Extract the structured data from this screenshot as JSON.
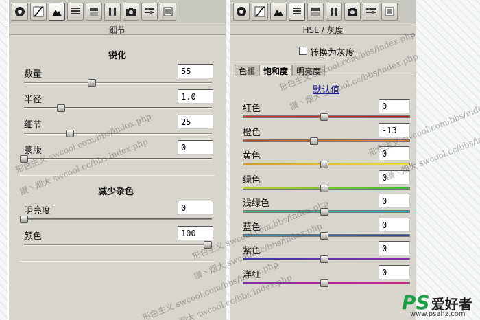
{
  "left": {
    "header": "细节",
    "sharpen_title": "锐化",
    "sharpen": [
      {
        "label": "数量",
        "value": "55",
        "level": 0.37
      },
      {
        "label": "半径",
        "value": "1.0",
        "level": 0.2
      },
      {
        "label": "细节",
        "value": "25",
        "level": 0.25
      },
      {
        "label": "蒙版",
        "value": "0",
        "level": 0.0
      }
    ],
    "noise_title": "减少杂色",
    "noise": [
      {
        "label": "明亮度",
        "value": "0",
        "level": 0.0
      },
      {
        "label": "颜色",
        "value": "100",
        "level": 1.0
      }
    ]
  },
  "right": {
    "header": "HSL / 灰度",
    "grayscale_label": "转换为灰度",
    "tabs": [
      "色相",
      "饱和度",
      "明亮度"
    ],
    "active_tab": 1,
    "default_link": "默认值",
    "channels": [
      {
        "label": "红色",
        "value": "0",
        "level": 0.5,
        "colors": [
          "#d23a2e",
          "#c4201c"
        ]
      },
      {
        "label": "橙色",
        "value": "-13",
        "level": 0.435,
        "colors": [
          "#b8522a",
          "#e88a1e"
        ]
      },
      {
        "label": "黄色",
        "value": "0",
        "level": 0.5,
        "colors": [
          "#d49a2a",
          "#f0e23a"
        ]
      },
      {
        "label": "绿色",
        "value": "0",
        "level": 0.5,
        "colors": [
          "#b6d02e",
          "#3cb83a"
        ]
      },
      {
        "label": "浅绿色",
        "value": "0",
        "level": 0.5,
        "colors": [
          "#3cb878",
          "#27b6c8"
        ]
      },
      {
        "label": "蓝色",
        "value": "0",
        "level": 0.5,
        "colors": [
          "#2aa0c8",
          "#2b3aa8"
        ]
      },
      {
        "label": "紫色",
        "value": "0",
        "level": 0.5,
        "colors": [
          "#3a3aa8",
          "#8a2aa8"
        ]
      },
      {
        "label": "洋红",
        "value": "0",
        "level": 0.5,
        "colors": [
          "#8a2aa8",
          "#c22a8a"
        ]
      }
    ]
  },
  "watermarks": [
    "形色主义 swcool.com/bbs/index.php",
    "讃丶烟大 swcool.cc/bbs/index.php"
  ],
  "logo": {
    "ps": "PS",
    "text": "爱好者",
    "url": "www.psahz.com"
  },
  "icons": [
    "aperture-icon",
    "curve-icon",
    "detail-icon",
    "hsl-icon",
    "split-tone-icon",
    "lens-icon",
    "camera-icon",
    "presets-icon",
    "snapshot-icon"
  ]
}
